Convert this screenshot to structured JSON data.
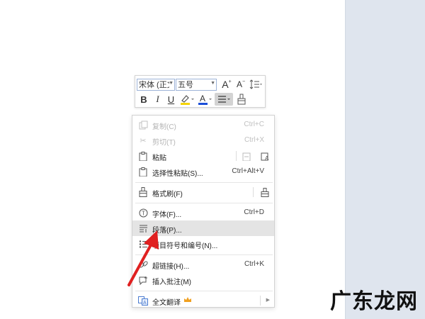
{
  "toolbar": {
    "font_name": "宋体 (正文",
    "font_size": "五号",
    "grow_font": "A",
    "shrink_font": "A",
    "bold": "B",
    "italic": "I",
    "underline": "U",
    "font_color_letter": "A",
    "highlight_color": "#f5d400",
    "font_color": "#1b4fd8"
  },
  "menu": {
    "copy": {
      "label": "复制(C)",
      "shortcut": "Ctrl+C"
    },
    "cut": {
      "label": "剪切(T)",
      "shortcut": "Ctrl+X"
    },
    "paste": {
      "label": "粘贴"
    },
    "paste_special": {
      "label": "选择性粘贴(S)...",
      "shortcut": "Ctrl+Alt+V"
    },
    "format_painter": {
      "label": "格式刷(F)"
    },
    "font": {
      "label": "字体(F)...",
      "shortcut": "Ctrl+D"
    },
    "paragraph": {
      "label": "段落(P)..."
    },
    "bullets": {
      "label": "项目符号和编号(N)..."
    },
    "hyperlink": {
      "label": "超链接(H)...",
      "shortcut": "Ctrl+K"
    },
    "insert_comment": {
      "label": "插入批注(M)"
    },
    "translate": {
      "label": "全文翻译"
    }
  },
  "watermark": "广东龙网",
  "colors": {
    "arrow": "#e02020",
    "side_panel": "#dfe5ee",
    "highlight": "#e4e4e4",
    "crown": "#f0a020"
  }
}
